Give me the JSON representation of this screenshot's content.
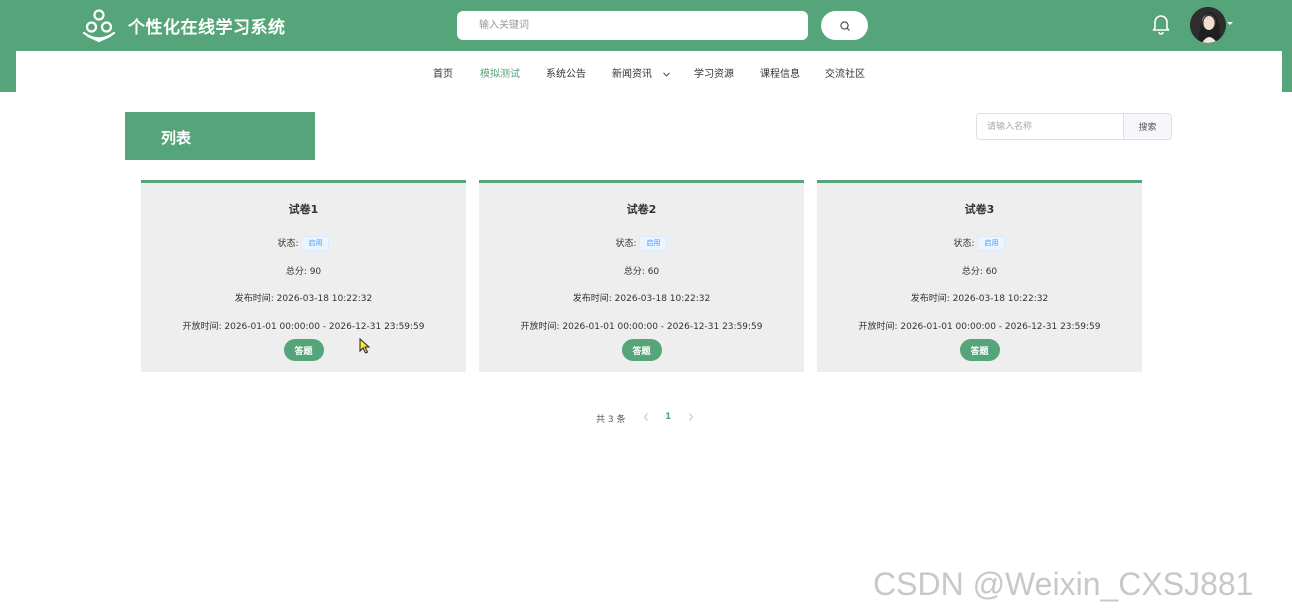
{
  "header": {
    "brand_title": "个性化在线学习系统",
    "search_placeholder": "输入关键词"
  },
  "nav": {
    "items": [
      {
        "label": "首页",
        "active": false
      },
      {
        "label": "模拟测试",
        "active": true
      },
      {
        "label": "系统公告",
        "active": false
      },
      {
        "label": "新闻资讯",
        "active": false,
        "has_dropdown": true
      },
      {
        "label": "学习资源",
        "active": false
      },
      {
        "label": "课程信息",
        "active": false
      },
      {
        "label": "交流社区",
        "active": false
      }
    ]
  },
  "list": {
    "title": "列表",
    "search_placeholder": "请输入名称",
    "search_button": "搜索"
  },
  "cards": [
    {
      "title": "试卷1",
      "status_label": "状态:",
      "status_value": "启用",
      "score_text": "总分: 90",
      "publish_text": "发布时间: 2026-03-18 10:22:32",
      "open_text": "开放时间: 2026-01-01 00:00:00 - 2026-12-31 23:59:59",
      "button": "答题"
    },
    {
      "title": "试卷2",
      "status_label": "状态:",
      "status_value": "启用",
      "score_text": "总分: 60",
      "publish_text": "发布时间: 2026-03-18 10:22:32",
      "open_text": "开放时间: 2026-01-01 00:00:00 - 2026-12-31 23:59:59",
      "button": "答题"
    },
    {
      "title": "试卷3",
      "status_label": "状态:",
      "status_value": "启用",
      "score_text": "总分: 60",
      "publish_text": "发布时间: 2026-03-18 10:22:32",
      "open_text": "开放时间: 2026-01-01 00:00:00 - 2026-12-31 23:59:59",
      "button": "答题"
    }
  ],
  "pagination": {
    "total": "共 3 条",
    "current_page": "1"
  },
  "watermark": "CSDN @Weixin_CXSJ881",
  "colors": {
    "primary": "#55a47a",
    "card_bg": "#eeeeee",
    "tag_text": "#409eff"
  }
}
